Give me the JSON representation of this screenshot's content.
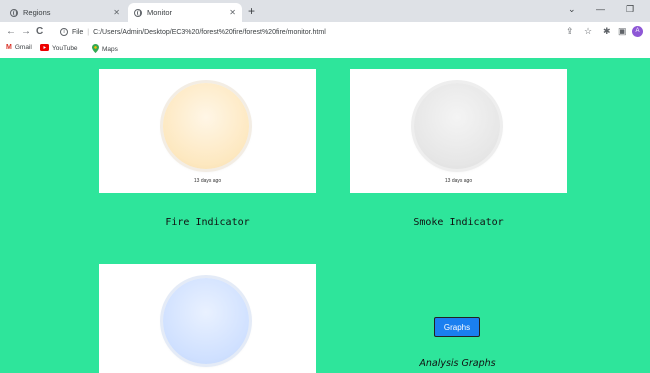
{
  "browser": {
    "tabs": [
      {
        "title": "Regions",
        "active": false
      },
      {
        "title": "Monitor",
        "active": true
      }
    ],
    "new_tab_symbol": "+",
    "nav": {
      "back": "←",
      "forward": "→",
      "reload": "C"
    },
    "url": {
      "scheme_label": "File",
      "path": "C:/Users/Admin/Desktop/EC3%20/forest%20fire/forest%20fire/monitor.html"
    },
    "avatar_letter": "A",
    "bookmarks": [
      {
        "label": "Gmail",
        "icon": "gmail-icon"
      },
      {
        "label": "YouTube",
        "icon": "youtube-icon"
      },
      {
        "label": "Maps",
        "icon": "maps-icon"
      }
    ]
  },
  "cards": [
    {
      "timestamp": "13 days ago",
      "label": "Fire Indicator",
      "color": "#fde8c0"
    },
    {
      "timestamp": "13 days ago",
      "label": "Smoke Indicator",
      "color": "#e6e6e6"
    },
    {
      "timestamp": "",
      "label": "",
      "color": "#cfe0ff"
    }
  ],
  "graphs_button": {
    "label": "Graphs"
  },
  "analysis_label": "Analysis Graphs",
  "colors": {
    "page_bg": "#2ee59b",
    "button_bg": "#1a7ff0"
  }
}
